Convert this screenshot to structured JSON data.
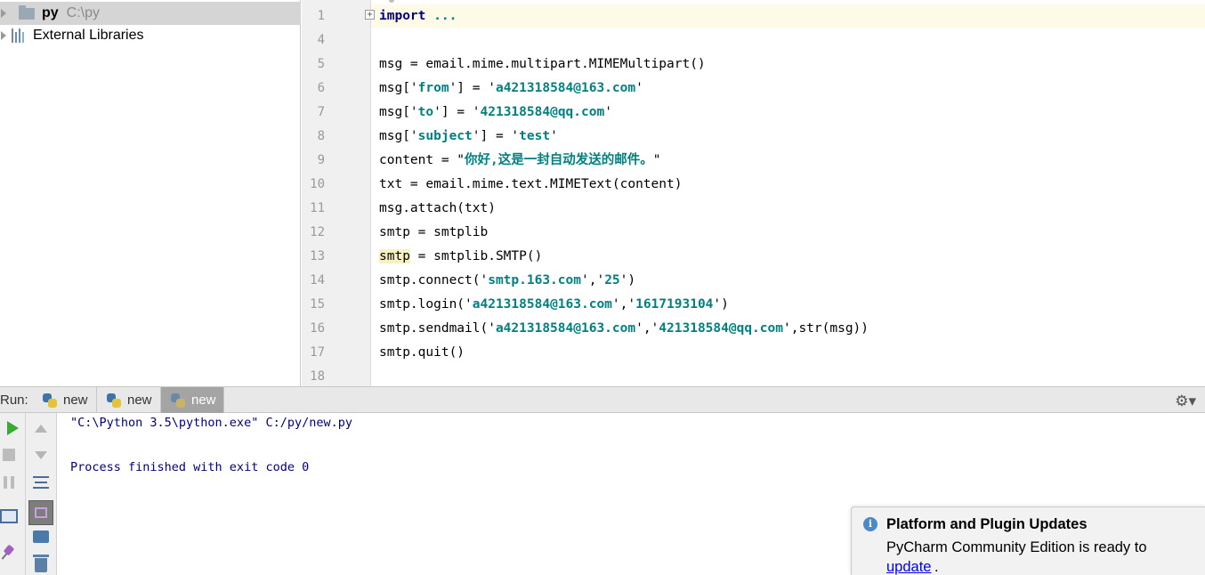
{
  "project": {
    "items": [
      {
        "name": "py",
        "path": "C:\\py"
      },
      {
        "name": "External Libraries"
      }
    ]
  },
  "editor": {
    "lines": [
      {
        "num": "1",
        "code": "import ..."
      },
      {
        "num": "4",
        "code": ""
      },
      {
        "num": "5",
        "code": "msg = email.mime.multipart.MIMEMultipart()"
      },
      {
        "num": "6",
        "code": "msg['from'] = 'a421318584@163.com'"
      },
      {
        "num": "7",
        "code": "msg['to'] = '421318584@qq.com'"
      },
      {
        "num": "8",
        "code": "msg['subject'] = 'test'"
      },
      {
        "num": "9",
        "code": "content = \"你好,这是一封自动发送的邮件。\""
      },
      {
        "num": "10",
        "code": "txt = email.mime.text.MIMEText(content)"
      },
      {
        "num": "11",
        "code": "msg.attach(txt)"
      },
      {
        "num": "12",
        "code": "smtp = smtplib"
      },
      {
        "num": "13",
        "code": "smtp = smtplib.SMTP()"
      },
      {
        "num": "14",
        "code": "smtp.connect('smtp.163.com','25')"
      },
      {
        "num": "15",
        "code": "smtp.login('a421318584@163.com','1617193104')"
      },
      {
        "num": "16",
        "code": "smtp.sendmail('a421318584@163.com','421318584@qq.com',str(msg))"
      },
      {
        "num": "17",
        "code": "smtp.quit()"
      },
      {
        "num": "18",
        "code": ""
      }
    ]
  },
  "run": {
    "label": "Run:",
    "tabs": [
      "new",
      "new",
      "new"
    ],
    "active_tab": 2,
    "console": [
      "\"C:\\Python 3.5\\python.exe\" C:/py/new.py",
      "",
      "Process finished with exit code 0"
    ]
  },
  "notification": {
    "title": "Platform and Plugin Updates",
    "body": "PyCharm Community Edition is ready to",
    "link": "update",
    "suffix": "."
  },
  "icons": {
    "settings": "gear-icon",
    "run": "play-icon",
    "stop": "stop-icon",
    "pause": "pause-icon"
  }
}
